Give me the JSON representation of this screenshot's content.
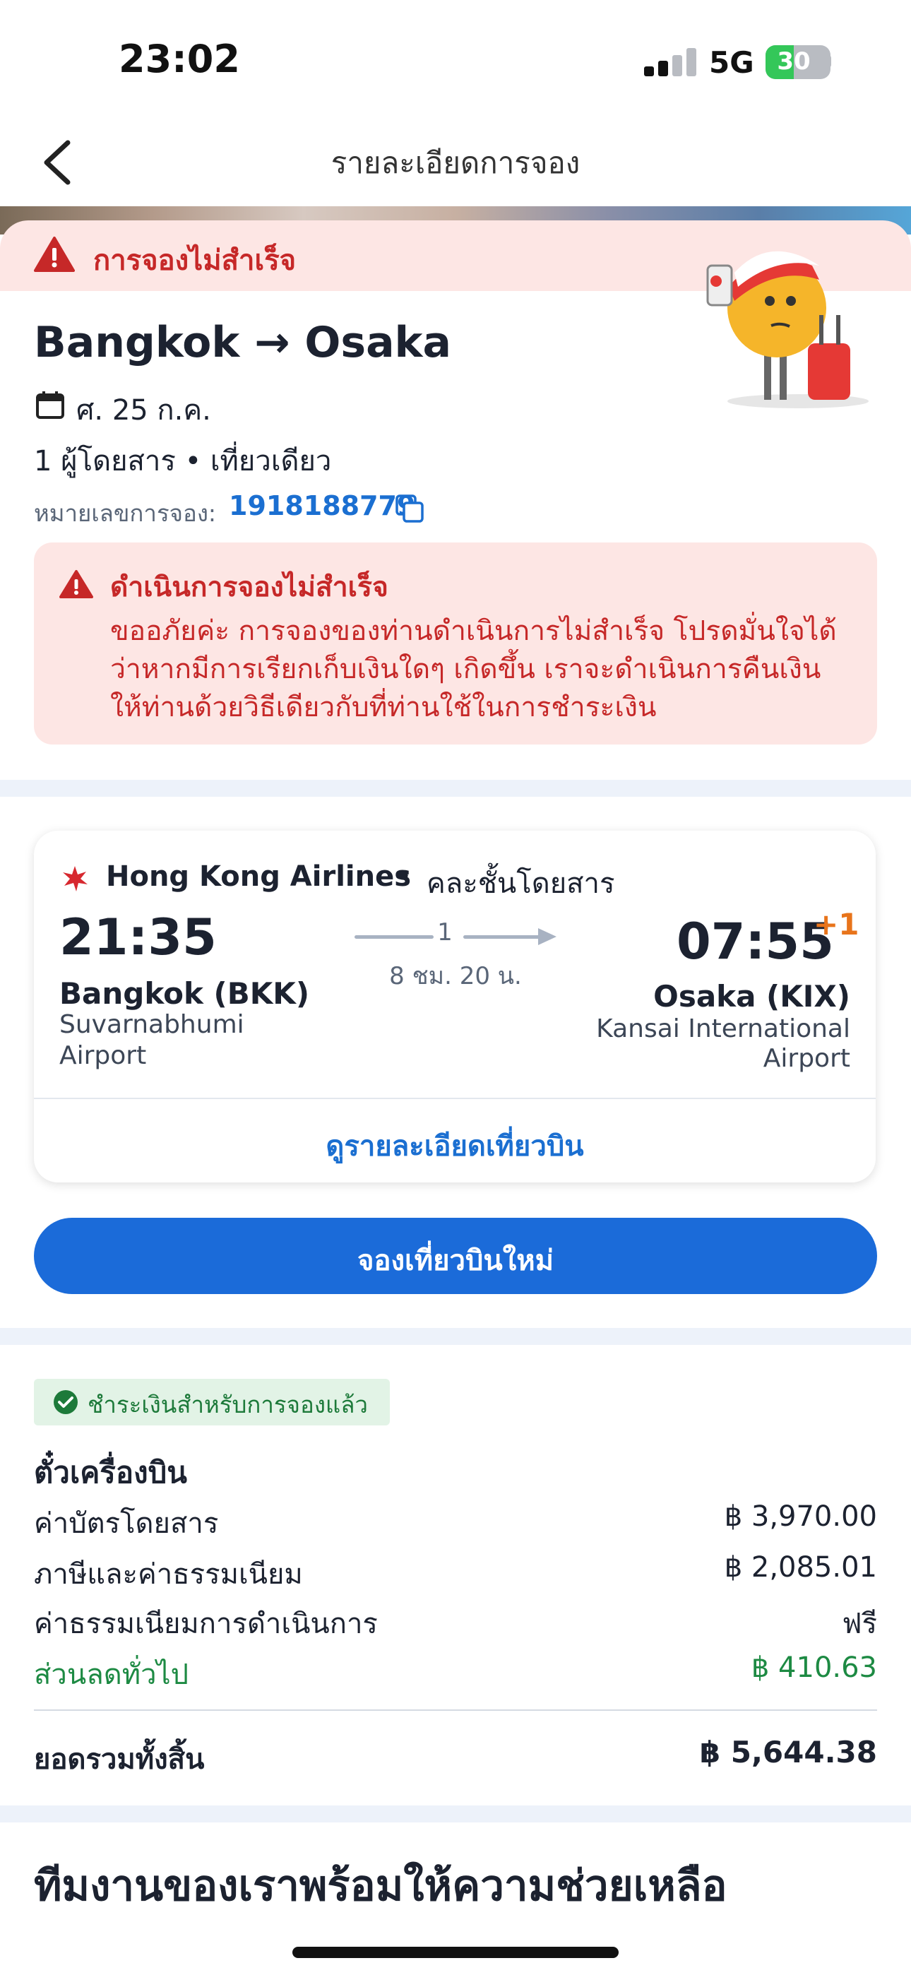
{
  "status": {
    "time": "23:02",
    "network": "5G",
    "battery": "30"
  },
  "nav": {
    "title": "รายละเอียดการจอง"
  },
  "banner": {
    "text": "การจองไม่สำเร็จ"
  },
  "trip": {
    "route": "Bangkok → Osaka",
    "date": "ศ. 25 ก.ค.",
    "passengers": "1 ผู้โดยสาร • เที่ยวเดียว",
    "ref_label": "หมายเลขการจอง:",
    "ref_number": "1918188779"
  },
  "alert": {
    "title": "ดำเนินการจองไม่สำเร็จ",
    "lines": [
      "ขออภัยค่ะ การจองของท่านดำเนินการไม่สำเร็จ โปรดมั่นใจได้",
      "ว่าหากมีการเรียกเก็บเงินใดๆ เกิดขึ้น เราจะดำเนินการคืนเงิน",
      "ให้ท่านด้วยวิธีเดียวกับที่ท่านใช้ในการชำระเงิน"
    ]
  },
  "flight": {
    "airline": "Hong Kong Airlines",
    "separator": "•",
    "cabin": "คละชั้นโดยสาร",
    "dep_time": "21:35",
    "arr_time": "07:55",
    "day_offset": "+1",
    "stops": "1",
    "duration": "8 ชม. 20 น.",
    "dep_city": "Bangkok (BKK)",
    "dep_airport_1": "Suvarnabhumi",
    "dep_airport_2": "Airport",
    "arr_city": "Osaka (KIX)",
    "arr_airport_1": "Kansai International",
    "arr_airport_2": "Airport",
    "details_link": "ดูรายละเอียดเที่ยวบิน"
  },
  "rebook_button": "จองเที่ยวบินใหม่",
  "price": {
    "paid_badge": "ชำระเงินสำหรับการจองแล้ว",
    "heading": "ตั๋วเครื่องบิน",
    "rows": [
      {
        "label": "ค่าบัตรโดยสาร",
        "value": "฿ 3,970.00"
      },
      {
        "label": "ภาษีและค่าธรรมเนียม",
        "value": "฿ 2,085.01"
      },
      {
        "label": "ค่าธรรมเนียมการดำเนินการ",
        "value": "ฟรี"
      },
      {
        "label": "ส่วนลดทั่วไป",
        "value": "฿ 410.63"
      }
    ],
    "total_label": "ยอดรวมทั้งสิ้น",
    "total_value": "฿ 5,644.38"
  },
  "help": {
    "heading": "ทีมงานของเราพร้อมให้ความช่วยเหลือ"
  },
  "colors": {
    "accent": "#1b6bd9",
    "error": "#c62828",
    "success": "#1d8a43",
    "day_offset": "#e8741b"
  }
}
